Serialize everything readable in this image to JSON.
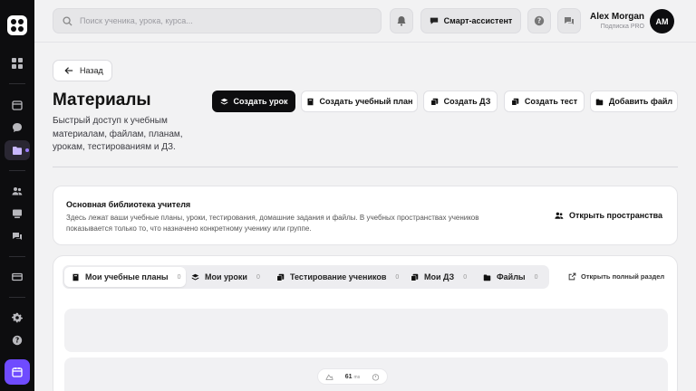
{
  "search": {
    "placeholder": "Поиск ученика, урока, курса..."
  },
  "header": {
    "assistant_label": "Смарт-ассистент",
    "user_name": "Alex Morgan",
    "user_plan": "Подписка PRO",
    "avatar_initials": "AM"
  },
  "page": {
    "back_label": "Назад",
    "title": "Материалы",
    "description": "Быстрый доступ к учебным материалам, файлам, планам, урокам, тестированиям и ДЗ."
  },
  "actions": [
    {
      "label": "Создать урок",
      "icon": "layers-icon"
    },
    {
      "label": "Создать учебный план",
      "icon": "book-icon"
    },
    {
      "label": "Создать ДЗ",
      "icon": "copy-icon"
    },
    {
      "label": "Создать тест",
      "icon": "test-icon"
    },
    {
      "label": "Добавить файл",
      "icon": "folder-icon"
    }
  ],
  "library": {
    "title": "Основная библиотека учителя",
    "text": "Здесь лежат ваши учебные планы, уроки, тестирования, домашние задания и файлы. В учебных пространствах учеников показывается только то, что назначено конкретному ученику или группе.",
    "open_label": "Открыть пространства"
  },
  "tabs": [
    {
      "label": "Мои учебные планы",
      "count": "0"
    },
    {
      "label": "Мои уроки",
      "count": "0"
    },
    {
      "label": "Тестирование учеников",
      "count": "0"
    },
    {
      "label": "Мои ДЗ",
      "count": "0"
    },
    {
      "label": "Файлы",
      "count": "0"
    }
  ],
  "full_section_label": "Открыть полный раздел",
  "perf": {
    "value": "61",
    "unit": "ms"
  },
  "colors": {
    "accent": "#6f4bff",
    "sidebar": "#0d0d0f",
    "background": "#f2f2f3"
  }
}
